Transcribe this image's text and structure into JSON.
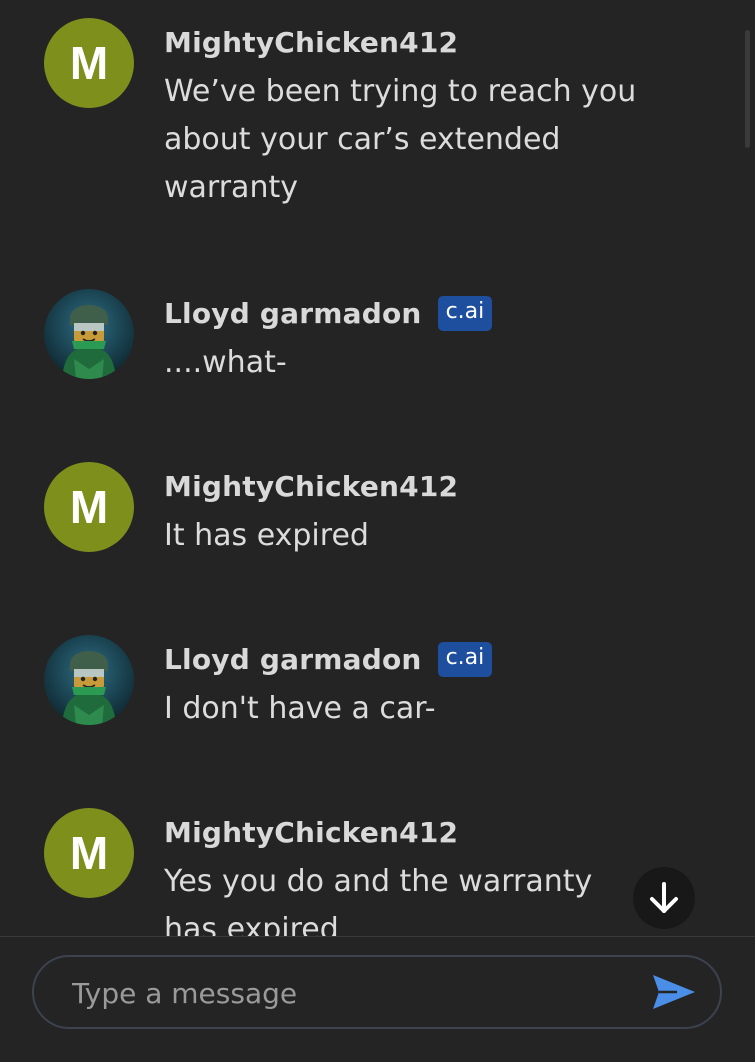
{
  "messages": [
    {
      "author": "MightyChicken412",
      "avatar_letter": "M",
      "text": "We’ve been trying to reach you about your car’s extended warranty"
    },
    {
      "author": "Lloyd garmadon",
      "badge": "c.ai",
      "avatar_icon": "lego-ninja-avatar",
      "text": "....what-"
    },
    {
      "author": "MightyChicken412",
      "avatar_letter": "M",
      "text": "It has expired"
    },
    {
      "author": "Lloyd garmadon",
      "badge": "c.ai",
      "avatar_icon": "lego-ninja-avatar",
      "text": "I don't have a car-"
    },
    {
      "author": "MightyChicken412",
      "avatar_letter": "M",
      "text": "Yes you do and the warranty has expired"
    }
  ],
  "composer": {
    "placeholder": "Type a message",
    "value": ""
  },
  "icons": {
    "scroll_down": "arrow-down-icon",
    "send": "send-icon"
  },
  "colors": {
    "background": "#242424",
    "user_avatar": "#7f8f1c",
    "badge": "#1d4f9e",
    "send_accent": "#4a8ee8"
  }
}
